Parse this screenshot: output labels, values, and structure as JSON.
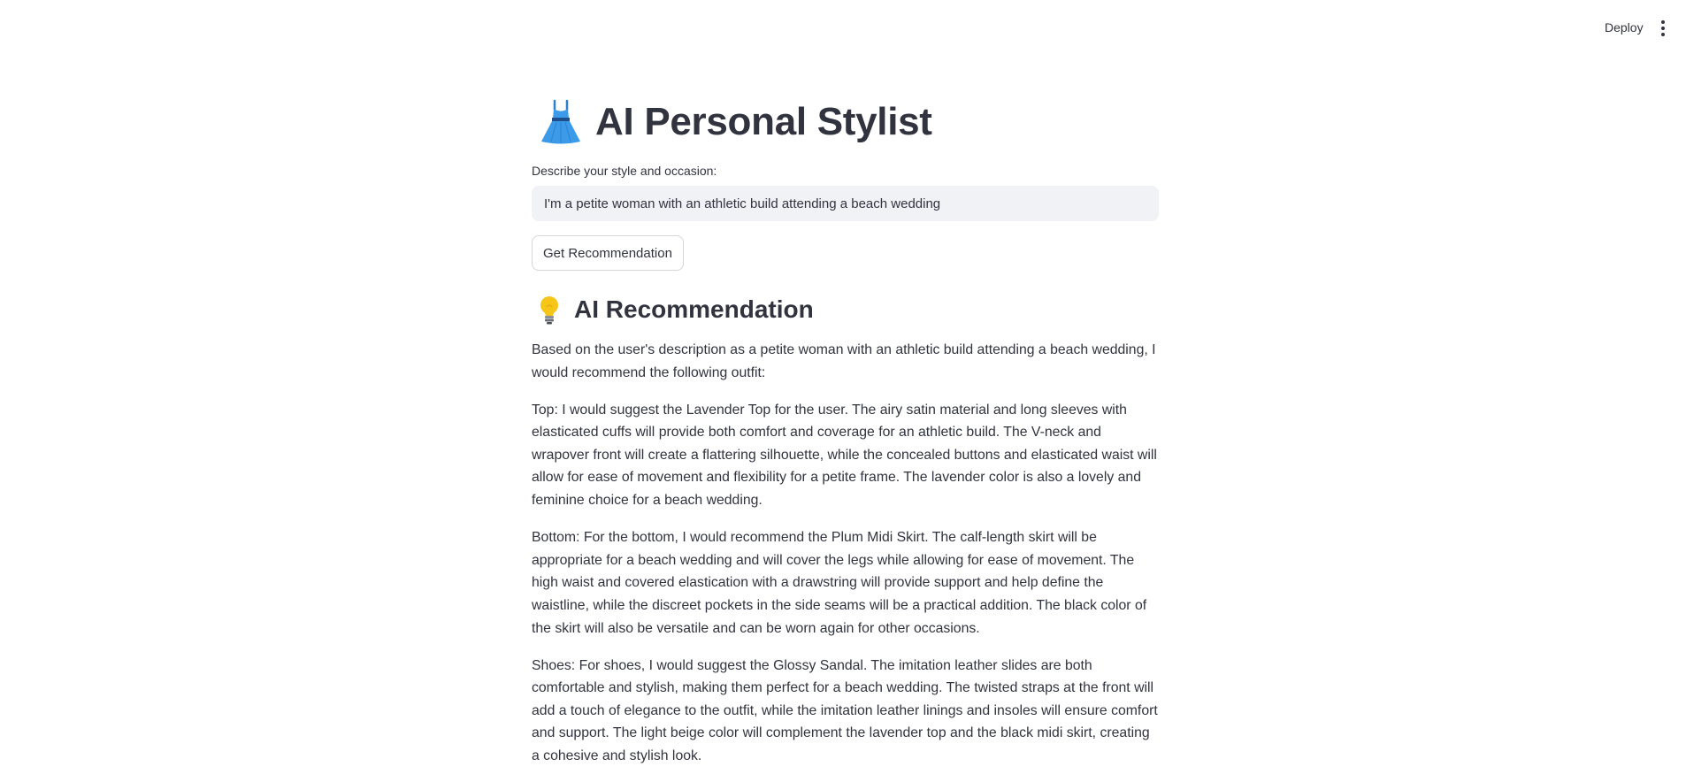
{
  "header": {
    "deploy_label": "Deploy",
    "menu_icon": "kebab-menu-icon"
  },
  "app": {
    "title": "AI Personal Stylist",
    "title_icon": "dress-icon"
  },
  "form": {
    "input_label": "Describe your style and occasion:",
    "input_value": "I'm a petite woman with an athletic build attending a beach wedding",
    "button_label": "Get Recommendation"
  },
  "recommendation": {
    "heading": "AI Recommendation",
    "heading_icon": "light-bulb-icon",
    "paragraphs": [
      "Based on the user's description as a petite woman with an athletic build attending a beach wedding, I would recommend the following outfit:",
      "Top: I would suggest the Lavender Top for the user. The airy satin material and long sleeves with elasticated cuffs will provide both comfort and coverage for an athletic build. The V-neck and wrapover front will create a flattering silhouette, while the concealed buttons and elasticated waist will allow for ease of movement and flexibility for a petite frame. The lavender color is also a lovely and feminine choice for a beach wedding.",
      "Bottom: For the bottom, I would recommend the Plum Midi Skirt. The calf-length skirt will be appropriate for a beach wedding and will cover the legs while allowing for ease of movement. The high waist and covered elastication with a drawstring will provide support and help define the waistline, while the discreet pockets in the side seams will be a practical addition. The black color of the skirt will also be versatile and can be worn again for other occasions.",
      "Shoes: For shoes, I would suggest the Glossy Sandal. The imitation leather slides are both comfortable and stylish, making them perfect for a beach wedding. The twisted straps at the front will add a touch of elegance to the outfit, while the imitation leather linings and insoles will ensure comfort and support. The light beige color will complement the lavender top and the black midi skirt, creating a cohesive and stylish look."
    ]
  },
  "colors": {
    "text": "#31333f",
    "input_bg": "#f0f2f6",
    "dress_blue": "#3b9be8",
    "bulb_yellow": "#f5c518"
  }
}
